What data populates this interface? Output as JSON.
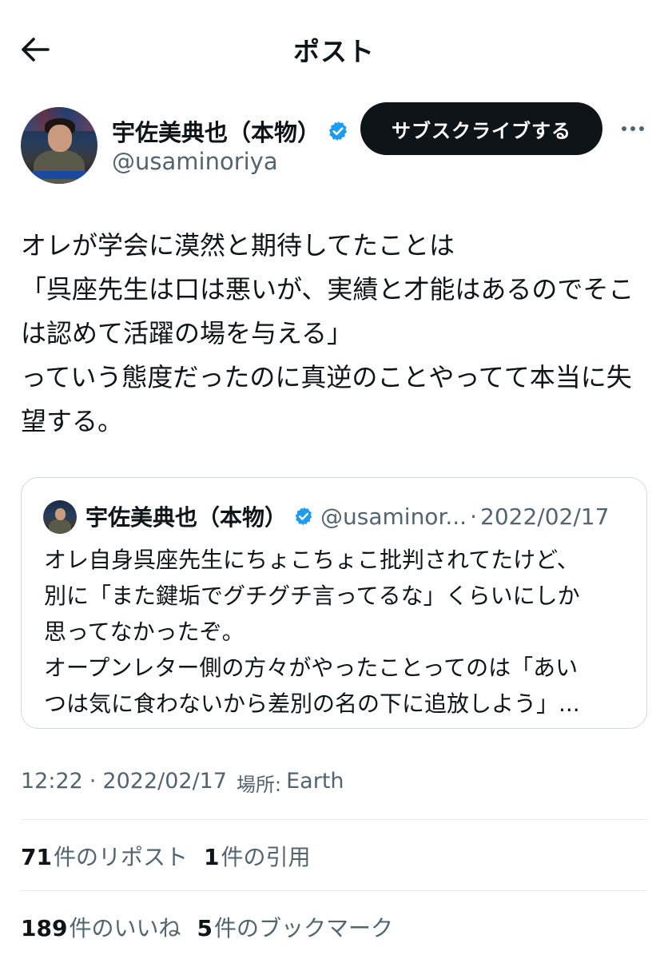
{
  "header": {
    "title": "ポスト"
  },
  "author": {
    "name": "宇佐美典也（本物）",
    "handle": "@usaminoriya",
    "subscribe_label": "サブスクライブする"
  },
  "tweet": {
    "text": "オレが学会に漠然と期待してたことは\n「呉座先生は口は悪いが、実績と才能はあるのでそこは認めて活躍の場を与える」\nっていう態度だったのに真逆のことやってて本当に失望する。"
  },
  "quote": {
    "name": "宇佐美典也（本物）",
    "handle": "@usaminor...",
    "separator": "·",
    "date": "2022/02/17",
    "text": "オレ自身呉座先生にちょこちょこ批判されてたけど、\n別に「また鍵垢でグチグチ言ってるな」くらいにしか\n思ってなかったぞ。\nオープンレター側の方々がやったことってのは「あい\nつは気に食わないから差別の名の下に追放しよう」..."
  },
  "meta": {
    "time": "12:22",
    "separator": "·",
    "date": "2022/02/17",
    "location_label": "場所:",
    "location": "Earth"
  },
  "stats": {
    "reposts_count": "71",
    "reposts_label": "件のリポスト",
    "quotes_count": "1",
    "quotes_label": "件の引用",
    "likes_count": "189",
    "likes_label": "件のいいね",
    "bookmarks_count": "5",
    "bookmarks_label": "件のブックマーク"
  },
  "colors": {
    "verified": "#1d9bf0",
    "secondary_text": "#536471",
    "button_bg": "#0f1419"
  },
  "icons": {
    "back": "arrow-left-icon",
    "verified": "verified-badge-icon",
    "more": "more-horizontal-icon"
  }
}
